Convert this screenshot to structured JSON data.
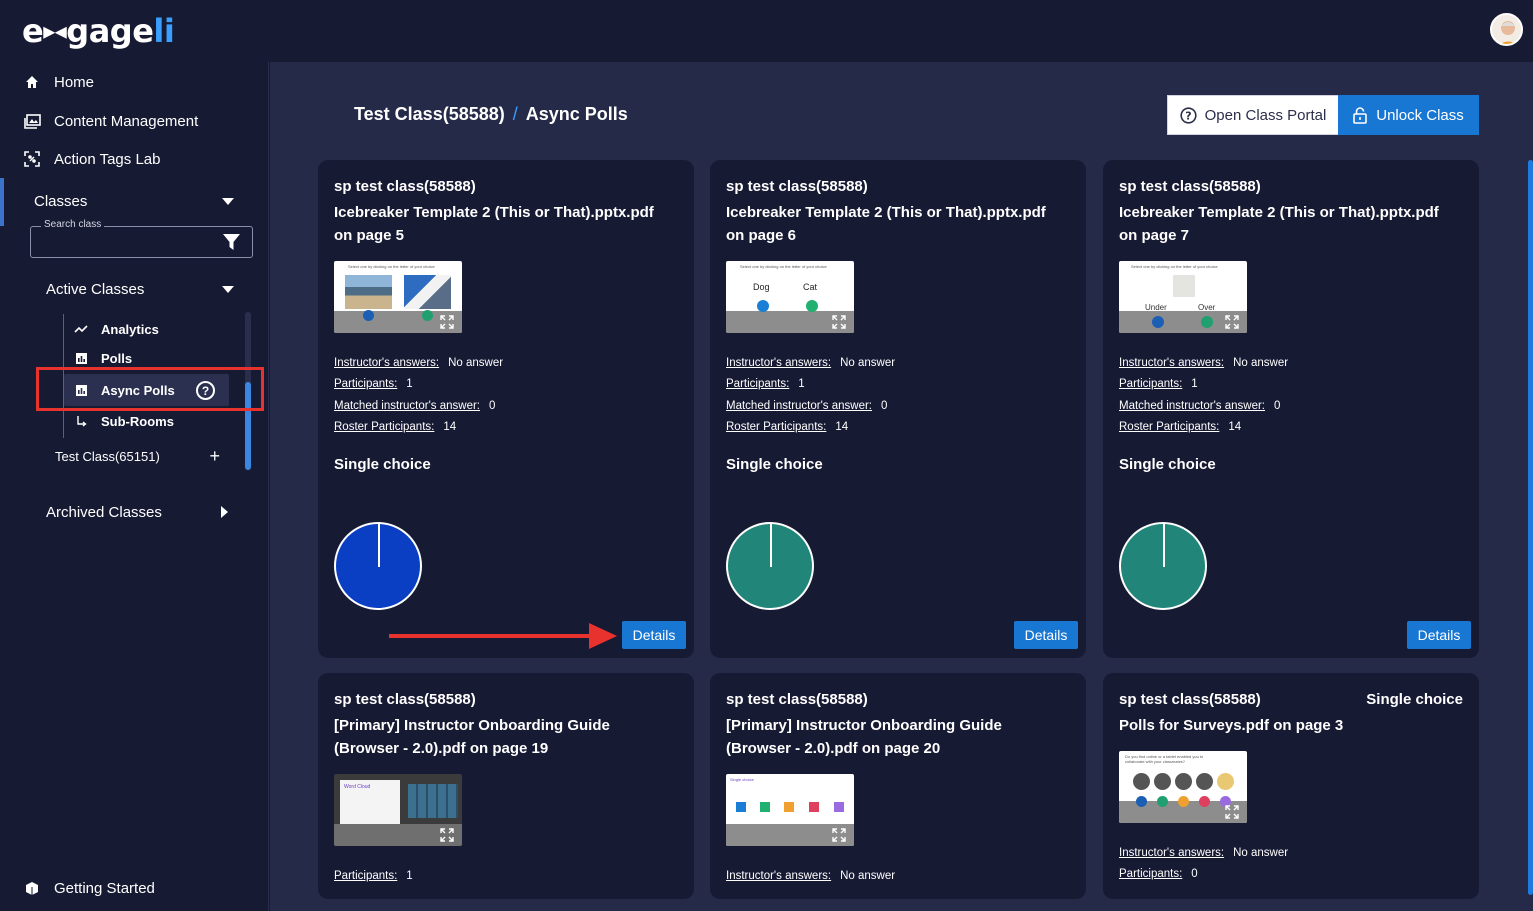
{
  "app": {
    "logo_left": "e",
    "logo_mid": "gage",
    "logo_accent": "li"
  },
  "sidebar": {
    "home": "Home",
    "content_management": "Content Management",
    "action_tags_lab": "Action Tags Lab",
    "classes": "Classes",
    "search_label": "Search class",
    "search_value": "",
    "active_classes": "Active Classes",
    "sub_items": [
      "Analytics",
      "Polls",
      "Async Polls",
      "Sub-Rooms"
    ],
    "other_class": "Test Class(65151)",
    "archived_classes": "Archived Classes",
    "getting_started": "Getting Started"
  },
  "header": {
    "class_name": "Test Class(58588)",
    "separator": "/",
    "page_name": "Async Polls",
    "open_portal": "Open Class Portal",
    "unlock_class": "Unlock Class"
  },
  "labels": {
    "instructor_answers": "Instructor's answers:",
    "participants": "Participants:",
    "matched": "Matched instructor's answer:",
    "roster": "Roster Participants:",
    "details": "Details"
  },
  "colors": {
    "pie_blue": "#0a3fc4",
    "pie_teal": "#21857a",
    "accent": "#1877d3",
    "annotation_red": "#e8322e"
  },
  "cards": [
    {
      "course": "sp test class(58588)",
      "title": "Icebreaker Template 2 (This or That).pptx.pdf on page 5",
      "thumb_caption": "Select one by clicking on the letter of your choice",
      "instructor_answers": "No answer",
      "participants": "1",
      "matched": "0",
      "roster": "14",
      "type": "Single choice"
    },
    {
      "course": "sp test class(58588)",
      "title": "Icebreaker Template 2 (This or That).pptx.pdf on page 6",
      "thumb_caption": "Select one by clicking on the letter of your choice",
      "thumb_left": "Dog",
      "thumb_right": "Cat",
      "instructor_answers": "No answer",
      "participants": "1",
      "matched": "0",
      "roster": "14",
      "type": "Single choice"
    },
    {
      "course": "sp test class(58588)",
      "title": "Icebreaker Template 2 (This or That).pptx.pdf on page 7",
      "thumb_caption": "Select one by clicking on the letter of your choice",
      "thumb_left": "Under",
      "thumb_right": "Over",
      "instructor_answers": "No answer",
      "participants": "1",
      "matched": "0",
      "roster": "14",
      "type": "Single choice"
    },
    {
      "course": "sp test class(58588)",
      "title": "[Primary] Instructor Onboarding Guide (Browser - 2.0).pdf on page 19",
      "thumb_caption": "Word Cloud",
      "participants": "1"
    },
    {
      "course": "sp test class(58588)",
      "title": "[Primary] Instructor Onboarding Guide (Browser - 2.0).pdf on page 20",
      "thumb_caption": "Single choice",
      "instructor_answers": "No answer"
    },
    {
      "course": "sp test class(58588)",
      "title": "Polls for Surveys.pdf on page 3",
      "type": "Single choice",
      "thumb_caption": "Do you find online or a tablet enabled you to collaborate with your classmates?",
      "instructor_answers": "No answer",
      "participants": "0"
    }
  ]
}
